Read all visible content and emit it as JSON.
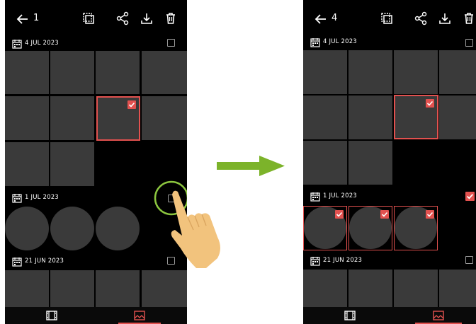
{
  "colors": {
    "accent": "#e2514f",
    "tile": "#3a3a3a",
    "arrow": "#7cb32a",
    "ring": "#8cc63f",
    "hand": "#f2c37d"
  },
  "before": {
    "header": {
      "count": "1"
    },
    "groups": [
      {
        "date": "4 JUL 2023",
        "checked": false
      },
      {
        "date": "1 JUL 2023",
        "checked": false
      },
      {
        "date": "21 JUN 2023",
        "checked": false
      }
    ]
  },
  "after": {
    "header": {
      "count": "4"
    },
    "groups": [
      {
        "date": "4 JUL 2023",
        "checked": false
      },
      {
        "date": "1 JUL 2023",
        "checked": true
      },
      {
        "date": "21 JUN 2023",
        "checked": false
      }
    ]
  },
  "icons": {
    "back": "arrow-left-icon",
    "select_all": "select-all-icon",
    "share": "share-icon",
    "download": "download-icon",
    "delete": "trash-icon",
    "calendar": "calendar-icon",
    "video_tab": "film-icon",
    "photo_tab": "image-icon"
  }
}
